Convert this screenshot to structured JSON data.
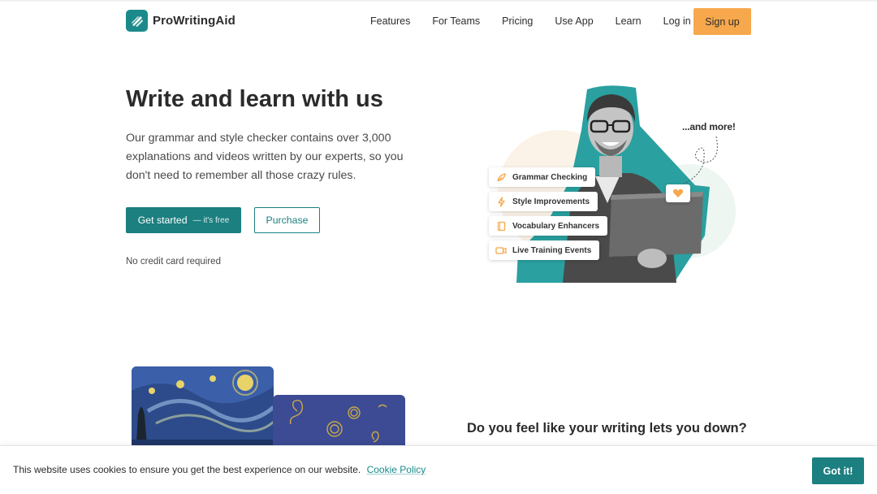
{
  "brand": {
    "name": "ProWritingAid",
    "accent": "#1c7f80",
    "cta_color": "#f7a84c"
  },
  "nav": {
    "items": [
      "Features",
      "For Teams",
      "Pricing",
      "Use App",
      "Learn",
      "Log in"
    ],
    "signup_label": "Sign up"
  },
  "hero": {
    "title": "Write and learn with us",
    "description": "Our grammar and style checker contains over 3,000 explanations and videos written by our experts, so you don't need to remember all those crazy rules.",
    "primary_button": "Get started",
    "primary_button_suffix": "— it's free",
    "secondary_button": "Purchase",
    "note": "No credit card required"
  },
  "illustration": {
    "and_more": "...and more!",
    "features": [
      {
        "label": "Grammar Checking",
        "icon": "feather-icon"
      },
      {
        "label": "Style Improvements",
        "icon": "lightning-icon"
      },
      {
        "label": "Vocabulary Enhancers",
        "icon": "book-icon"
      },
      {
        "label": "Live Training Events",
        "icon": "video-icon"
      }
    ]
  },
  "section2": {
    "question": "Do you feel like your writing lets you down?"
  },
  "cookie": {
    "text": "This website uses cookies to ensure you get the best experience on our website.",
    "link": "Cookie Policy",
    "button": "Got it!"
  }
}
